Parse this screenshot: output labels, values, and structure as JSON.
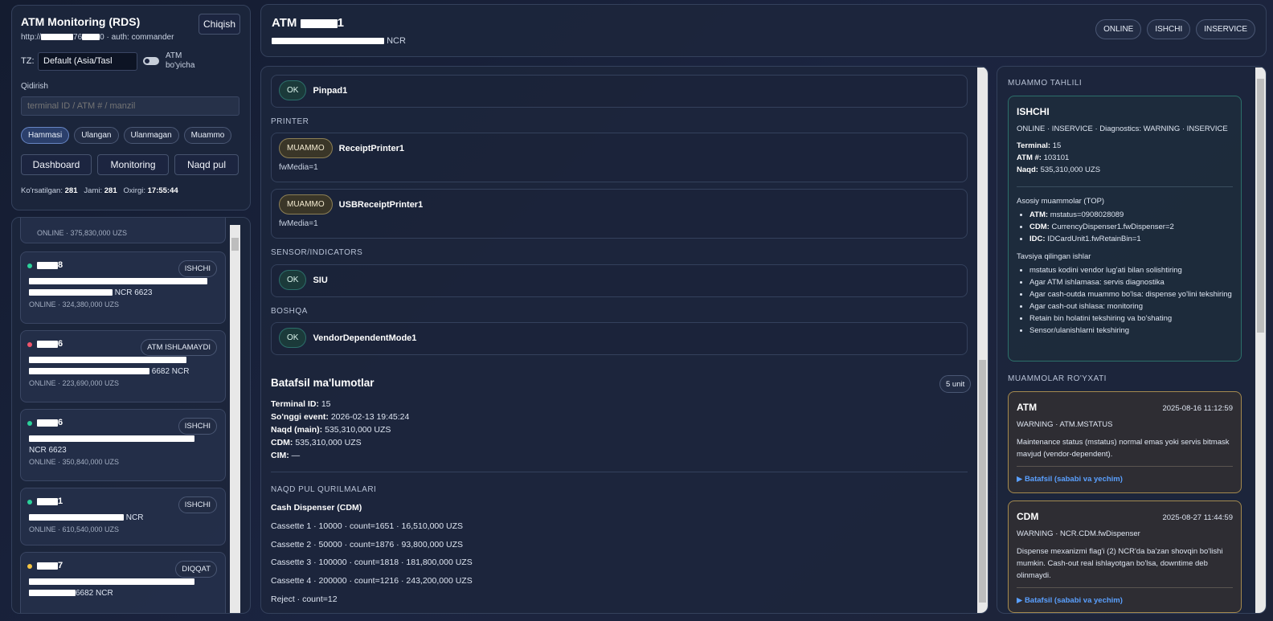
{
  "sidebar": {
    "title": "ATM Monitoring (RDS)",
    "url_prefix": "http://",
    "url_mid": "76",
    "url_suffix": "0 · auth: commander",
    "logout": "Chiqish",
    "tz_label": "TZ:",
    "tz_value": "Default (Asia/Tasl",
    "tz_check_label": "ATM bo'yicha",
    "search_label": "Qidirish",
    "search_placeholder": "terminal ID / ATM # / manzil",
    "filters": [
      "Hammasi",
      "Ulangan",
      "Ulanmagan",
      "Muammo"
    ],
    "nav": [
      "Dashboard",
      "Monitoring",
      "Naqd pul"
    ],
    "stats": {
      "shown_label": "Ko'rsatilgan:",
      "shown": "281",
      "total_label": "Jami:",
      "total": "281",
      "last_label": "Oxirgi:",
      "last": "17:55:44"
    }
  },
  "list": {
    "top_meta": "ONLINE · 375,830,000 UZS",
    "cards": [
      {
        "name_suffix": "8",
        "status": "ISHCHI",
        "dot": "#2bd19a",
        "addr_end": "NCR 6623",
        "meta": "ONLINE · 324,380,000 UZS"
      },
      {
        "name_suffix": "6",
        "status": "ATM ISHLAMAYDI",
        "dot": "#f0556b",
        "addr_end": "6682 NCR",
        "meta": "ONLINE · 223,690,000 UZS"
      },
      {
        "name_suffix": "6",
        "status": "ISHCHI",
        "dot": "#2bd19a",
        "addr_end": "NCR 6623",
        "meta": "ONLINE · 350,840,000 UZS"
      },
      {
        "name_suffix": "1",
        "status": "ISHCHI",
        "dot": "#2bd19a",
        "addr_end": "NCR",
        "meta": "ONLINE · 610,540,000 UZS"
      },
      {
        "name_suffix": "7",
        "status": "DIQQAT",
        "dot": "#f5c542",
        "addr_end": "6682 NCR",
        "meta": ""
      }
    ]
  },
  "header": {
    "title_prefix": "ATM",
    "title_suffix": "1",
    "subtitle_end": "NCR",
    "pills": [
      "ONLINE",
      "ISHCHI",
      "INSERVICE"
    ]
  },
  "sensors": {
    "pinpad": {
      "status": "OK",
      "name": "Pinpad1"
    },
    "printer_label": "PRINTER",
    "receipt": {
      "status": "MUAMMO",
      "name": "ReceiptPrinter1",
      "extra": "fwMedia=1"
    },
    "usb_receipt": {
      "status": "MUAMMO",
      "name": "USBReceiptPrinter1",
      "extra": "fwMedia=1"
    },
    "sensor_label": "SENSOR/INDICATORS",
    "siu": {
      "status": "OK",
      "name": "SIU"
    },
    "other_label": "BOSHQA",
    "vendor": {
      "status": "OK",
      "name": "VendorDependentMode1"
    }
  },
  "details": {
    "title": "Batafsil ma'lumotlar",
    "unit_count": "5 unit",
    "terminal_label": "Terminal ID:",
    "terminal": "15",
    "event_label": "So'nggi event:",
    "event": "2026-02-13 19:45:24",
    "cash_label": "Naqd (main):",
    "cash": "535,310,000 UZS",
    "cdm_label": "CDM:",
    "cdm": "535,310,000 UZS",
    "cim_label": "CIM:",
    "cim": "—",
    "devices_label": "NAQD PUL QURILMALARI",
    "dispenser_title": "Cash Dispenser (CDM)",
    "cassettes": [
      "Cassette 1 · 10000 · count=1651 · 16,510,000 UZS",
      "Cassette 2 · 50000 · count=1876 · 93,800,000 UZS",
      "Cassette 3 · 100000 · count=1818 · 181,800,000 UZS",
      "Cassette 4 · 200000 · count=1216 · 243,200,000 UZS",
      "Reject · count=12"
    ]
  },
  "analysis": {
    "section": "MUAMMO TAHLILI",
    "title": "ISHCHI",
    "subtitle": "ONLINE · INSERVICE · Diagnostics: WARNING · INSERVICE",
    "terminal_label": "Terminal:",
    "terminal": "15",
    "atm_label": "ATM #:",
    "atm": "103101",
    "cash_label": "Naqd:",
    "cash": "535,310,000 UZS",
    "top_head": "Asosiy muammolar (TOP)",
    "top": [
      {
        "k": "ATM:",
        "v": "mstatus=0908028089"
      },
      {
        "k": "CDM:",
        "v": "CurrencyDispenser1.fwDispenser=2"
      },
      {
        "k": "IDC:",
        "v": "IDCardUnit1.fwRetainBin=1"
      }
    ],
    "rec_head": "Tavsiya qilingan ishlar",
    "rec": [
      "mstatus kodini vendor lug'ati bilan solishtiring",
      "Agar ATM ishlamasa: servis diagnostika",
      "Agar cash-outda muammo bo'lsa: dispense yo'lini tekshiring",
      "Agar cash-out ishlasa: monitoring",
      "Retain bin holatini tekshiring va bo'shating",
      "Sensor/ulanishlarni tekshiring"
    ]
  },
  "issues": {
    "section": "MUAMMOLAR RO'YXATI",
    "items": [
      {
        "title": "ATM",
        "date": "2025-08-16 11:12:59",
        "sub": "WARNING · ATM.MSTATUS",
        "desc": "Maintenance status (mstatus) normal emas yoki servis bitmask mavjud (vendor-dependent).",
        "link": "▶ Batafsil (sababi va yechim)"
      },
      {
        "title": "CDM",
        "date": "2025-08-27 11:44:59",
        "sub": "WARNING · NCR.CDM.fwDispenser",
        "desc": "Dispense mexanizmi flag'i (2) NCR'da ba'zan shovqin bo'lishi mumkin. Cash-out real ishlayotgan bo'lsa, downtime deb olinmaydi.",
        "link": "▶ Batafsil (sababi va yechim)"
      }
    ]
  }
}
